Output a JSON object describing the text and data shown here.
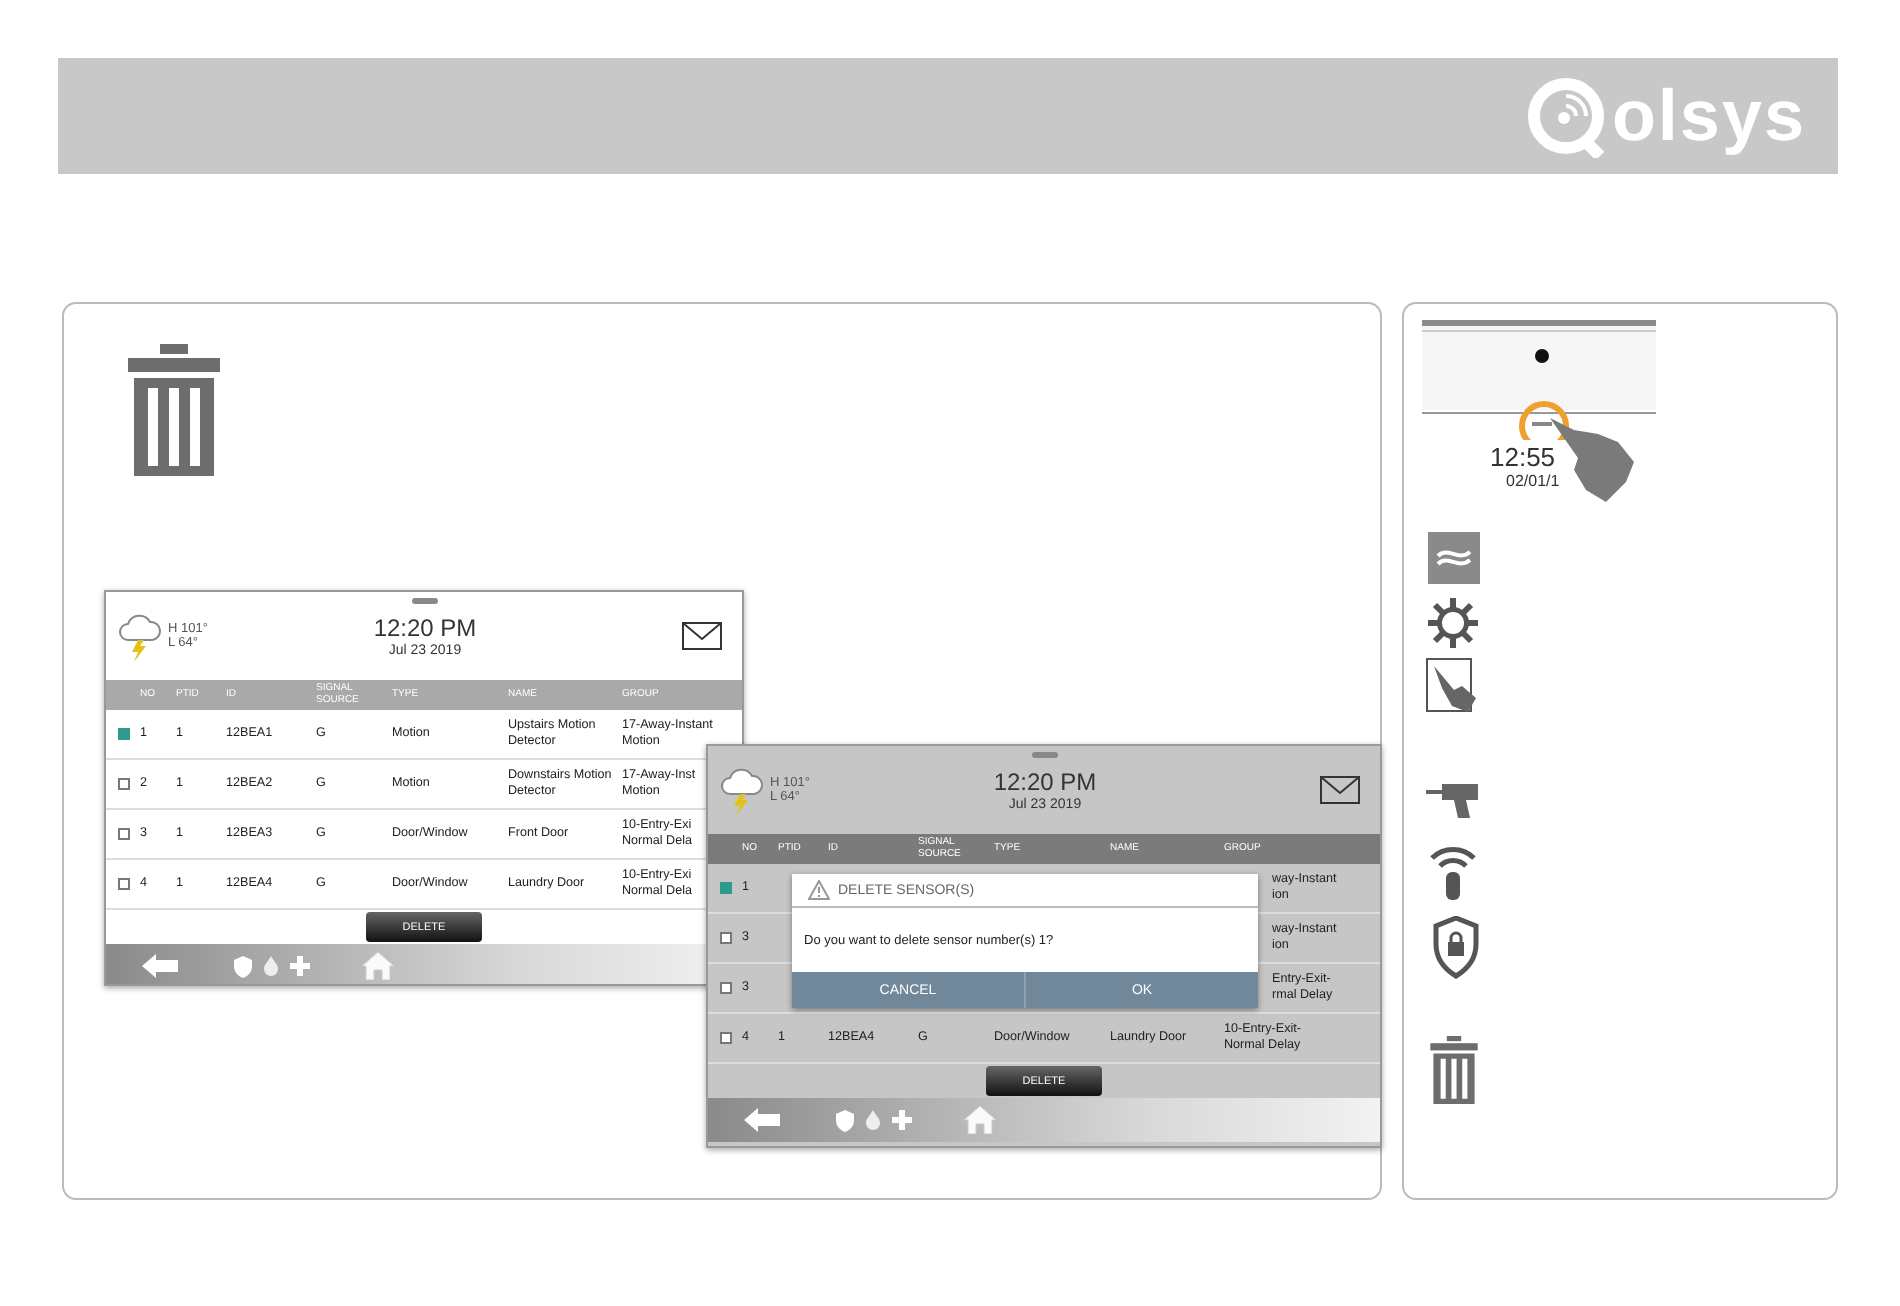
{
  "header": {
    "logo_text": "olsys"
  },
  "main_panel": {
    "screens": [
      {
        "weather": {
          "high": "H 101°",
          "low": "L 64°"
        },
        "time": "12:20 PM",
        "date": "Jul 23 2019",
        "dimmed": false,
        "columns": [
          "NO",
          "PTID",
          "ID",
          "SIGNAL SOURCE",
          "TYPE",
          "NAME",
          "GROUP"
        ],
        "rows": [
          {
            "kind": "full",
            "checked": true,
            "cells": [
              "1",
              "1",
              "12BEA1",
              "G",
              "Motion",
              "Upstairs Motion Detector",
              "17-Away-Instant\nMotion"
            ]
          },
          {
            "kind": "full",
            "checked": false,
            "cells": [
              "2",
              "1",
              "12BEA2",
              "G",
              "Motion",
              "Downstairs Motion Detector",
              "17-Away-Inst\nMotion"
            ]
          },
          {
            "kind": "full",
            "checked": false,
            "cells": [
              "3",
              "1",
              "12BEA3",
              "G",
              "Door/Window",
              "Front Door",
              "10-Entry-Exi\nNormal Dela"
            ]
          },
          {
            "kind": "full",
            "checked": false,
            "cells": [
              "4",
              "1",
              "12BEA4",
              "G",
              "Door/Window",
              "Laundry Door",
              "10-Entry-Exi\nNormal Dela"
            ]
          }
        ],
        "delete_button": "DELETE"
      },
      {
        "weather": {
          "high": "H 101°",
          "low": "L 64°"
        },
        "time": "12:20 PM",
        "date": "Jul 23 2019",
        "dimmed": true,
        "columns": [
          "NO",
          "PTID",
          "ID",
          "SIGNAL SOURCE",
          "TYPE",
          "NAME",
          "GROUP"
        ],
        "rows": [
          {
            "kind": "covered",
            "checked": true,
            "no": "1",
            "group": "way-Instant\nion"
          },
          {
            "kind": "covered",
            "checked": false,
            "no": "3",
            "group": "way-Instant\nion"
          },
          {
            "kind": "covered",
            "checked": false,
            "no": "3",
            "group": "Entry-Exit-\nrmal Delay"
          },
          {
            "kind": "full",
            "checked": false,
            "cells": [
              "4",
              "1",
              "12BEA4",
              "G",
              "Door/Window",
              "Laundry Door",
              "10-Entry-Exit-\nNormal Delay"
            ]
          }
        ],
        "delete_button": "DELETE",
        "dialog": {
          "title": "DELETE SENSOR(S)",
          "message": "Do you want to delete sensor number(s) 1?",
          "buttons": [
            "CANCEL",
            "OK"
          ]
        }
      }
    ]
  },
  "side_panel": {
    "clock": {
      "time": "12:55",
      "date": "02/01/1"
    }
  }
}
